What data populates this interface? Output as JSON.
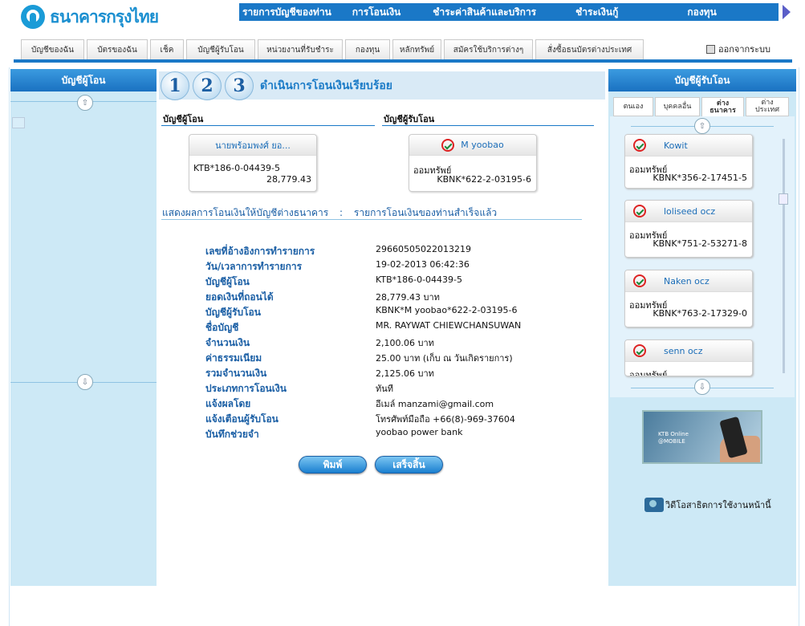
{
  "brand": {
    "name": "ธนาคารกรุงไทย"
  },
  "top_nav": [
    "รายการบัญชีของท่าน",
    "การโอนเงิน",
    "ชำระค่าสินค้าและบริการ",
    "ชำระเงินกู้",
    "กองทุน"
  ],
  "logout_label": "ออกจากระบบ",
  "tabs": [
    "บัญชีของฉัน",
    "บัตรของฉัน",
    "เช็ค",
    "บัญชีผู้รับโอน",
    "หน่วยงานที่รับชำระ",
    "กองทุน",
    "หลักทรัพย์",
    "สมัครใช้บริการต่างๆ",
    "สั่งซื้อธนบัตรต่างประเทศ"
  ],
  "left_panel": {
    "title": "บัญชีผู้โอน"
  },
  "steps": {
    "numbers": [
      "1",
      "2",
      "3"
    ],
    "title": "ดำเนินการโอนเงินเรียบร้อย"
  },
  "from_section": {
    "label": "บัญชีผู้โอน",
    "card_name": "นายพร้อมพงศ์ ยอ...",
    "account": "KTB*186-0-04439-5",
    "balance": "28,779.43"
  },
  "to_section": {
    "label": "บัญชีผู้รับโอน",
    "card_name": "M yoobao",
    "type": "ออมทรัพย์",
    "account": "KBNK*622-2-03195-6"
  },
  "result_line": {
    "left": "แสดงผลการโอนเงินให้บัญชีต่างธนาคาร",
    "sep": ":",
    "right": "รายการโอนเงินของท่านสำเร็จแล้ว"
  },
  "details": [
    {
      "label": "เลขที่อ้างอิงการทำรายการ",
      "value": "29660505022013219"
    },
    {
      "label": "วัน/เวลาการทำรายการ",
      "value": "19-02-2013 06:42:36"
    },
    {
      "label": "บัญชีผู้โอน",
      "value": "KTB*186-0-04439-5"
    },
    {
      "label": "ยอดเงินที่ถอนได้",
      "value": "28,779.43 บาท"
    },
    {
      "label": "บัญชีผู้รับโอน",
      "value": "KBNK*M yoobao*622-2-03195-6"
    },
    {
      "label": "ชื่อบัญชี",
      "value": "MR. RAYWAT CHIEWCHANSUWAN"
    },
    {
      "label": "จำนวนเงิน",
      "value": "2,100.06 บาท"
    },
    {
      "label": "ค่าธรรมเนียม",
      "value": "25.00 บาท (เก็บ ณ วันเกิดรายการ)"
    },
    {
      "label": "รวมจำนวนเงิน",
      "value": "2,125.06 บาท"
    },
    {
      "label": "ประเภทการโอนเงิน",
      "value": "ทันที"
    },
    {
      "label": "แจ้งผลโดย",
      "value": "อีเมล์   manzami@gmail.com"
    },
    {
      "label": "แจ้งเตือนผู้รับโอน",
      "value": "โทรศัพท์มือถือ +66(8)-969-37604"
    },
    {
      "label": "บันทึกช่วยจำ",
      "value": "yoobao power bank"
    }
  ],
  "buttons": {
    "print": "พิมพ์",
    "finish": "เสร็จสิ้น"
  },
  "right_panel": {
    "title": "บัญชีผู้รับโอน",
    "tabs": [
      "ตนเอง",
      "บุคคลอื่น",
      "ต่าง\nธนาคาร",
      "ต่าง\nประเทศ"
    ],
    "cards": [
      {
        "name": "Kowit",
        "type": "ออมทรัพย์",
        "account": "KBNK*356-2-17451-5"
      },
      {
        "name": "loliseed ocz",
        "type": "ออมทรัพย์",
        "account": "KBNK*751-2-53271-8"
      },
      {
        "name": "Naken ocz",
        "type": "ออมทรัพย์",
        "account": "KBNK*763-2-17329-0"
      },
      {
        "name": "senn ocz",
        "type": "ออมทรัพย์",
        "account": ""
      }
    ],
    "banner": {
      "text1": "KTB Online",
      "text2": "@MOBILE"
    },
    "video_label": "วิดีโอสาธิตการใช้งานหน้านี้"
  },
  "colors": {
    "brand_blue": "#1a78c7",
    "panel_bg": "#cde9f6",
    "label_blue": "#1b5fa5"
  }
}
